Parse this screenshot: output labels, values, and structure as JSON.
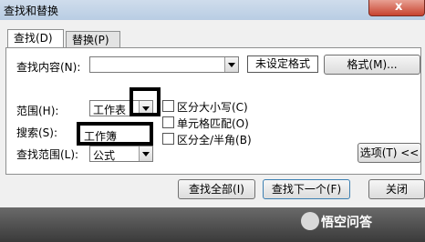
{
  "window": {
    "title": "查找和替换",
    "close": "x"
  },
  "tabs": [
    {
      "label": "查找(D)"
    },
    {
      "label": "替换(P)"
    }
  ],
  "find": {
    "content_label": "查找内容(N):",
    "content_value": "",
    "format_status": "未设定格式",
    "format_button": "格式(M)..."
  },
  "options": {
    "range_label": "范围(H):",
    "range_value": "工作表",
    "search_label": "搜索(S):",
    "search_value": "工作簿",
    "lookin_label": "查找范围(L):",
    "lookin_value": "公式",
    "match_case": "区分大小写(C)",
    "match_cell": "单元格匹配(O)",
    "match_width": "区分全/半角(B)",
    "options_button": "选项(T) <<"
  },
  "buttons": {
    "find_all": "查找全部(I)",
    "find_next": "查找下一个(F)",
    "close": "关闭"
  },
  "watermark": "悟空问答"
}
